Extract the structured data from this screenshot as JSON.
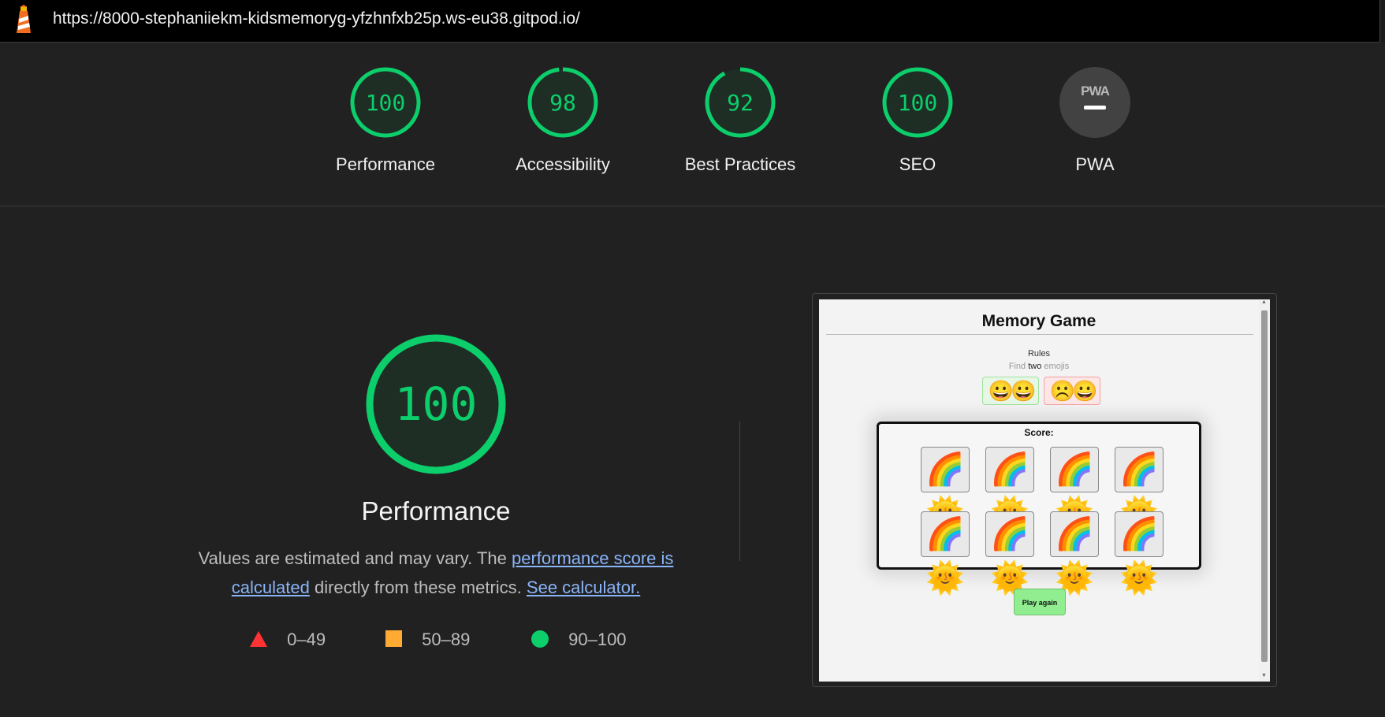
{
  "browser": {
    "url": "https://8000-stephaniiekm-kidsmemoryg-yfzhnfxb25p.ws-eu38.gitpod.io/"
  },
  "summary": [
    {
      "label": "Performance",
      "score": "100",
      "value": 100
    },
    {
      "label": "Accessibility",
      "score": "98",
      "value": 98
    },
    {
      "label": "Best Practices",
      "score": "92",
      "value": 92
    },
    {
      "label": "SEO",
      "score": "100",
      "value": 100
    },
    {
      "label": "PWA",
      "score": "",
      "badge": "PWA"
    }
  ],
  "performance": {
    "score": "100",
    "title": "Performance",
    "desc_prefix": "Values are estimated and may vary. The ",
    "link_score": "performance score is calculated",
    "desc_mid": " directly from these metrics. ",
    "link_calc": "See calculator.",
    "legend": [
      {
        "shape": "triangle",
        "range": "0–49",
        "color": "#ff3333"
      },
      {
        "shape": "square",
        "range": "50–89",
        "color": "#ffaa33"
      },
      {
        "shape": "circle",
        "range": "90–100",
        "color": "#0cce6b"
      }
    ]
  },
  "screenshot": {
    "title": "Memory Game",
    "rules_label": "Rules",
    "rules_find": "Find",
    "rules_two": "two",
    "rules_emojis": "emojis",
    "good_example": "😀😀",
    "bad_example": "☹️😀",
    "score_label": "Score:",
    "card_emoji": "🌈🌞",
    "button_label": "Play again"
  },
  "colors": {
    "pass": "#0cce6b",
    "background": "#212121",
    "link": "#8ab4f8"
  }
}
